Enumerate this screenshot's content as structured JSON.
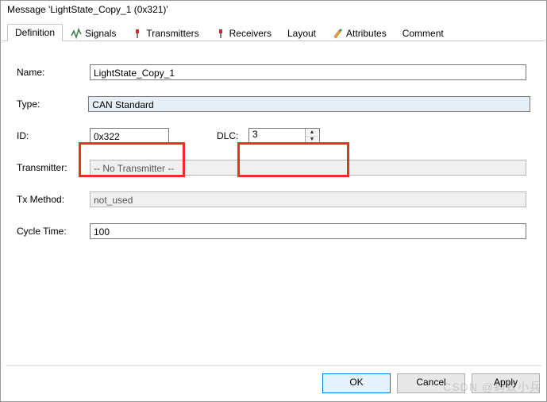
{
  "window": {
    "title": "Message 'LightState_Copy_1 (0x321)'"
  },
  "tabs": {
    "definition": "Definition",
    "signals": "Signals",
    "transmitters": "Transmitters",
    "receivers": "Receivers",
    "layout": "Layout",
    "attributes": "Attributes",
    "comment": "Comment"
  },
  "labels": {
    "name": "Name:",
    "type": "Type:",
    "id": "ID:",
    "dlc": "DLC:",
    "transmitter": "Transmitter:",
    "txmethod": "Tx Method:",
    "cycletime": "Cycle Time:"
  },
  "values": {
    "name": "LightState_Copy_1",
    "type": "CAN Standard",
    "id": "0x322",
    "dlc": "3",
    "transmitter": "-- No Transmitter --",
    "txmethod": "not_used",
    "cycletime": "100"
  },
  "buttons": {
    "ok": "OK",
    "cancel": "Cancel",
    "apply": "Apply"
  },
  "watermark": "CSDN @蚂蚁小兵"
}
